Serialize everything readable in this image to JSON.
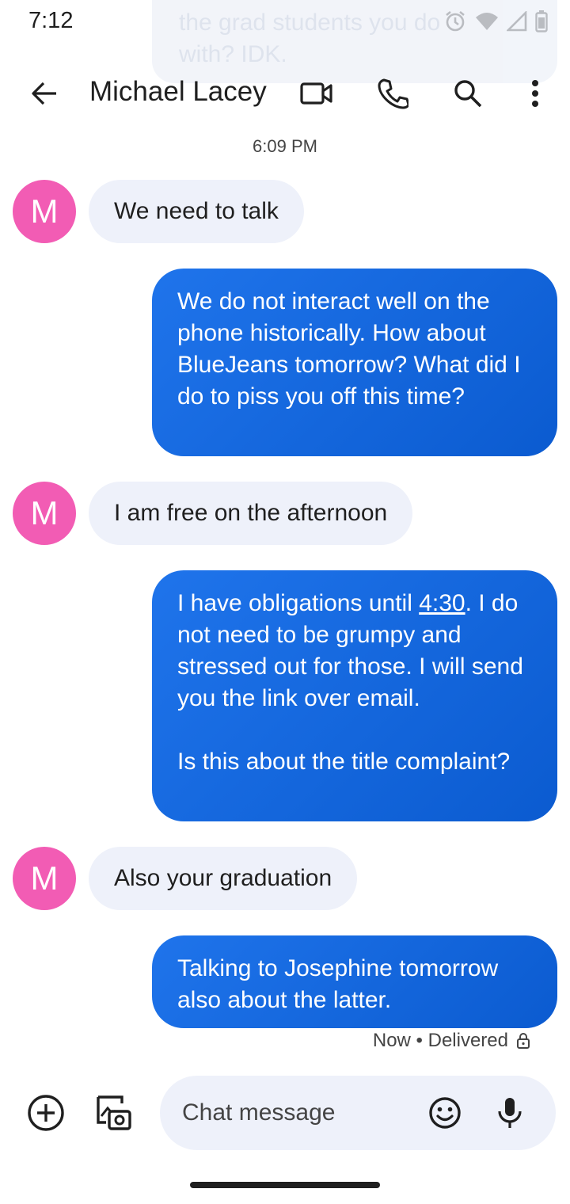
{
  "status_bar": {
    "time": "7:12",
    "icons": [
      "alarm-icon",
      "wifi-icon",
      "signal-icon",
      "battery-icon"
    ]
  },
  "notification_peek": {
    "line1": "the grad students you do",
    "line2": "with? IDK."
  },
  "header": {
    "contact_name": "Michael Lacey",
    "actions": [
      "video-call-icon",
      "phone-icon",
      "search-icon",
      "more-icon"
    ]
  },
  "conversation": {
    "timestamp": "6:09 PM",
    "avatar_initial": "M",
    "avatar_color": "#f25cb4",
    "messages": [
      {
        "direction": "in",
        "text": "We need to talk"
      },
      {
        "direction": "out",
        "text": "We do not interact well on the phone historically. How about BlueJeans tomorrow? What did I do to piss you off this time?"
      },
      {
        "direction": "in",
        "text": "I am free on the afternoon"
      },
      {
        "direction": "out",
        "text_before_link": "I have obligations until ",
        "link": "4:30",
        "text_after_link": ". I do not need to be grumpy and stressed out for those. I will send you the link over email.",
        "text_para2": "Is this about the title complaint?"
      },
      {
        "direction": "in",
        "text": "Also your graduation"
      },
      {
        "direction": "out",
        "text": "Talking to Josephine tomorrow also about the latter."
      }
    ],
    "delivery_status": "Now • Delivered"
  },
  "compose": {
    "placeholder": "Chat message"
  },
  "colors": {
    "outgoing_bubble": "#1a6be0",
    "incoming_bubble": "#eef1fa",
    "avatar": "#f25cb4"
  }
}
